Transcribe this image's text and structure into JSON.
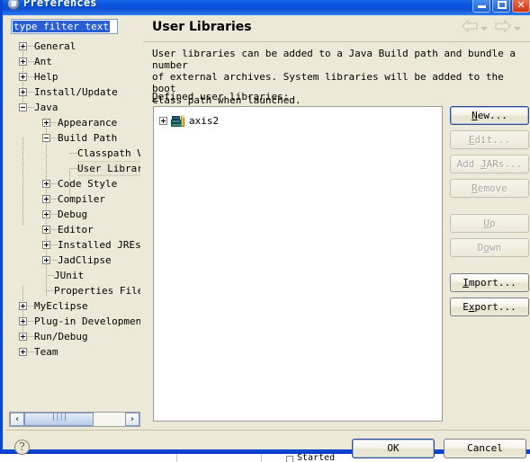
{
  "window": {
    "title": "Preferences",
    "icon": "preferences-icon",
    "controls": {
      "minimize": "minimize-button",
      "maximize": "maximize-button",
      "close": "close-button"
    }
  },
  "filter": {
    "value": "type filter text",
    "placeholder": "type filter text"
  },
  "tree": {
    "items": [
      {
        "label": "General",
        "depth": 0,
        "state": "collapsed",
        "selected": false
      },
      {
        "label": "Ant",
        "depth": 0,
        "state": "collapsed",
        "selected": false
      },
      {
        "label": "Help",
        "depth": 0,
        "state": "collapsed",
        "selected": false
      },
      {
        "label": "Install/Update",
        "depth": 0,
        "state": "collapsed",
        "selected": false
      },
      {
        "label": "Java",
        "depth": 0,
        "state": "expanded",
        "selected": false
      },
      {
        "label": "Appearance",
        "depth": 1,
        "state": "collapsed",
        "selected": false
      },
      {
        "label": "Build Path",
        "depth": 1,
        "state": "expanded",
        "selected": false
      },
      {
        "label": "Classpath Vari",
        "depth": 2,
        "state": "leaf",
        "selected": false
      },
      {
        "label": "User Libraries",
        "depth": 2,
        "state": "leaf",
        "selected": true
      },
      {
        "label": "Code Style",
        "depth": 1,
        "state": "collapsed",
        "selected": false
      },
      {
        "label": "Compiler",
        "depth": 1,
        "state": "collapsed",
        "selected": false
      },
      {
        "label": "Debug",
        "depth": 1,
        "state": "collapsed",
        "selected": false
      },
      {
        "label": "Editor",
        "depth": 1,
        "state": "collapsed",
        "selected": false
      },
      {
        "label": "Installed JREs",
        "depth": 1,
        "state": "collapsed",
        "selected": false
      },
      {
        "label": "JadClipse",
        "depth": 1,
        "state": "collapsed",
        "selected": false
      },
      {
        "label": "JUnit",
        "depth": 1,
        "state": "leaf",
        "selected": false
      },
      {
        "label": "Properties Files",
        "depth": 1,
        "state": "leaf",
        "selected": false
      },
      {
        "label": "MyEclipse",
        "depth": 0,
        "state": "collapsed",
        "selected": false
      },
      {
        "label": "Plug-in Development",
        "depth": 0,
        "state": "collapsed",
        "selected": false
      },
      {
        "label": "Run/Debug",
        "depth": 0,
        "state": "collapsed",
        "selected": false
      },
      {
        "label": "Team",
        "depth": 0,
        "state": "collapsed",
        "selected": false
      }
    ]
  },
  "scrollbar": {
    "left_arrow": "‹",
    "right_arrow": "›",
    "grip": "||||"
  },
  "page": {
    "title": "User Libraries",
    "description": "User libraries can be added to a Java Build path and bundle a number\nof external archives. System libraries will be added to the boot\nclass path when launched.",
    "list_label_mnemonic": "D",
    "list_label_rest": "efined user libraries:",
    "nav": {
      "back": "back-arrow",
      "forward": "forward-arrow"
    }
  },
  "library_list": {
    "items": [
      {
        "name": "axis2",
        "state": "collapsed",
        "icon": "library-books-icon"
      }
    ]
  },
  "side_buttons": [
    {
      "label": "New...",
      "mnemonic": "N",
      "enabled": true,
      "name": "new-button"
    },
    {
      "label": "Edit...",
      "mnemonic": "E",
      "enabled": false,
      "name": "edit-button"
    },
    {
      "label": "Add JARs...",
      "mnemonic": "J",
      "enabled": false,
      "name": "add-jars-button"
    },
    {
      "label": "Remove",
      "mnemonic": "R",
      "enabled": false,
      "name": "remove-button"
    },
    {
      "label": "Up",
      "mnemonic": "U",
      "enabled": false,
      "name": "up-button"
    },
    {
      "label": "Down",
      "mnemonic": "o",
      "enabled": false,
      "name": "down-button"
    },
    {
      "label": "Import...",
      "mnemonic": "I",
      "enabled": true,
      "name": "import-button"
    },
    {
      "label": "Export...",
      "mnemonic": "x",
      "enabled": true,
      "name": "export-button"
    }
  ],
  "footer": {
    "help": "?",
    "ok": "OK",
    "cancel": "Cancel"
  },
  "background_window": {
    "text": "Started"
  },
  "colors": {
    "titlebar_blue": "#0a52dd",
    "dialog_face": "#ece9d8",
    "selection_blue": "#2a5fd4",
    "close_red": "#cf3311",
    "list_white": "#ffffff"
  }
}
